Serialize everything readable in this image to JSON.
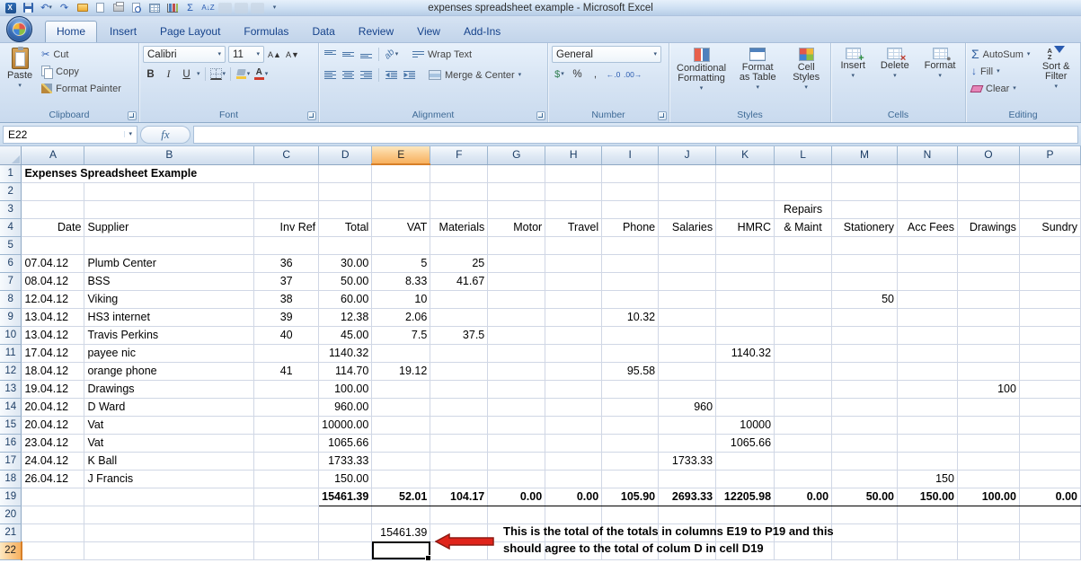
{
  "window": {
    "title": "expenses spreadsheet example - Microsoft Excel"
  },
  "icons": {
    "dropdown": "▾",
    "scissors": "✂",
    "sigma": "Σ",
    "undo": "↶",
    "redo": "↷",
    "bold": "B",
    "italic": "I",
    "underline": "U",
    "grow_font": "A▲",
    "shrink_font": "A▼",
    "font_a": "A",
    "dollar": "$",
    "percent": "%",
    "comma": ",",
    "increase_decimal": "←.0",
    "decrease_decimal": ".00→",
    "fill_down": "↓",
    "sort_az": "A↓Z"
  },
  "ribbon": {
    "tabs": [
      {
        "label": "Home",
        "active": true
      },
      {
        "label": "Insert"
      },
      {
        "label": "Page Layout"
      },
      {
        "label": "Formulas"
      },
      {
        "label": "Data"
      },
      {
        "label": "Review"
      },
      {
        "label": "View"
      },
      {
        "label": "Add-Ins"
      }
    ],
    "clipboard": {
      "label": "Clipboard",
      "paste": "Paste",
      "cut": "Cut",
      "copy": "Copy",
      "format_painter": "Format Painter"
    },
    "font": {
      "label": "Font",
      "family": "Calibri",
      "size": "11"
    },
    "alignment": {
      "label": "Alignment",
      "wrap_text": "Wrap Text",
      "merge_center": "Merge & Center"
    },
    "number": {
      "label": "Number",
      "format": "General"
    },
    "styles": {
      "label": "Styles",
      "conditional_formatting": "Conditional Formatting",
      "format_as_table": "Format as Table",
      "cell_styles": "Cell Styles"
    },
    "cells": {
      "label": "Cells",
      "insert": "Insert",
      "delete": "Delete",
      "format": "Format"
    },
    "editing": {
      "label": "Editing",
      "autosum": "AutoSum",
      "fill": "Fill",
      "clear": "Clear",
      "sort_filter": "Sort & Filter"
    }
  },
  "formula_bar": {
    "name_box": "E22",
    "fx_label": "fx"
  },
  "sheet": {
    "col_headers": [
      "A",
      "B",
      "C",
      "D",
      "E",
      "F",
      "G",
      "H",
      "I",
      "J",
      "K",
      "L",
      "M",
      "N",
      "O",
      "P"
    ],
    "row_count": 22,
    "selected_cell": "E22",
    "selected_col": "E",
    "selected_row": 22,
    "cells": [
      {
        "r": 1,
        "c": "A",
        "v": "Expenses Spreadsheet Example",
        "b": 1,
        "span": 3
      },
      {
        "r": 3,
        "c": "L",
        "v": "Repairs",
        "a": "center"
      },
      {
        "r": 4,
        "c": "A",
        "v": "Date",
        "a": "right"
      },
      {
        "r": 4,
        "c": "B",
        "v": "Supplier"
      },
      {
        "r": 4,
        "c": "C",
        "v": "Inv Ref",
        "a": "right"
      },
      {
        "r": 4,
        "c": "D",
        "v": "Total",
        "a": "right"
      },
      {
        "r": 4,
        "c": "E",
        "v": "VAT",
        "a": "right"
      },
      {
        "r": 4,
        "c": "F",
        "v": "Materials",
        "a": "right"
      },
      {
        "r": 4,
        "c": "G",
        "v": "Motor",
        "a": "right"
      },
      {
        "r": 4,
        "c": "H",
        "v": "Travel",
        "a": "right"
      },
      {
        "r": 4,
        "c": "I",
        "v": "Phone",
        "a": "right"
      },
      {
        "r": 4,
        "c": "J",
        "v": "Salaries",
        "a": "right"
      },
      {
        "r": 4,
        "c": "K",
        "v": "HMRC",
        "a": "right"
      },
      {
        "r": 4,
        "c": "L",
        "v": "& Maint",
        "a": "center"
      },
      {
        "r": 4,
        "c": "M",
        "v": "Stationery",
        "a": "right"
      },
      {
        "r": 4,
        "c": "N",
        "v": "Acc Fees",
        "a": "right"
      },
      {
        "r": 4,
        "c": "O",
        "v": "Drawings",
        "a": "right"
      },
      {
        "r": 4,
        "c": "P",
        "v": "Sundry",
        "a": "right"
      },
      {
        "r": 6,
        "c": "A",
        "v": "07.04.12"
      },
      {
        "r": 6,
        "c": "B",
        "v": "Plumb Center"
      },
      {
        "r": 6,
        "c": "C",
        "v": "36",
        "a": "center"
      },
      {
        "r": 6,
        "c": "D",
        "v": "30.00",
        "a": "right"
      },
      {
        "r": 6,
        "c": "E",
        "v": "5",
        "a": "right"
      },
      {
        "r": 6,
        "c": "F",
        "v": "25",
        "a": "right"
      },
      {
        "r": 7,
        "c": "A",
        "v": "08.04.12"
      },
      {
        "r": 7,
        "c": "B",
        "v": "BSS"
      },
      {
        "r": 7,
        "c": "C",
        "v": "37",
        "a": "center"
      },
      {
        "r": 7,
        "c": "D",
        "v": "50.00",
        "a": "right"
      },
      {
        "r": 7,
        "c": "E",
        "v": "8.33",
        "a": "right"
      },
      {
        "r": 7,
        "c": "F",
        "v": "41.67",
        "a": "right"
      },
      {
        "r": 8,
        "c": "A",
        "v": "12.04.12"
      },
      {
        "r": 8,
        "c": "B",
        "v": "Viking"
      },
      {
        "r": 8,
        "c": "C",
        "v": "38",
        "a": "center"
      },
      {
        "r": 8,
        "c": "D",
        "v": "60.00",
        "a": "right"
      },
      {
        "r": 8,
        "c": "E",
        "v": "10",
        "a": "right"
      },
      {
        "r": 8,
        "c": "M",
        "v": "50",
        "a": "right"
      },
      {
        "r": 9,
        "c": "A",
        "v": "13.04.12"
      },
      {
        "r": 9,
        "c": "B",
        "v": "HS3 internet"
      },
      {
        "r": 9,
        "c": "C",
        "v": "39",
        "a": "center"
      },
      {
        "r": 9,
        "c": "D",
        "v": "12.38",
        "a": "right"
      },
      {
        "r": 9,
        "c": "E",
        "v": "2.06",
        "a": "right"
      },
      {
        "r": 9,
        "c": "I",
        "v": "10.32",
        "a": "right"
      },
      {
        "r": 10,
        "c": "A",
        "v": "13.04.12"
      },
      {
        "r": 10,
        "c": "B",
        "v": "Travis Perkins"
      },
      {
        "r": 10,
        "c": "C",
        "v": "40",
        "a": "center"
      },
      {
        "r": 10,
        "c": "D",
        "v": "45.00",
        "a": "right"
      },
      {
        "r": 10,
        "c": "E",
        "v": "7.5",
        "a": "right"
      },
      {
        "r": 10,
        "c": "F",
        "v": "37.5",
        "a": "right"
      },
      {
        "r": 11,
        "c": "A",
        "v": "17.04.12"
      },
      {
        "r": 11,
        "c": "B",
        "v": "payee nic"
      },
      {
        "r": 11,
        "c": "D",
        "v": "1140.32",
        "a": "right"
      },
      {
        "r": 11,
        "c": "K",
        "v": "1140.32",
        "a": "right"
      },
      {
        "r": 12,
        "c": "A",
        "v": "18.04.12"
      },
      {
        "r": 12,
        "c": "B",
        "v": "orange phone"
      },
      {
        "r": 12,
        "c": "C",
        "v": "41",
        "a": "center"
      },
      {
        "r": 12,
        "c": "D",
        "v": "114.70",
        "a": "right"
      },
      {
        "r": 12,
        "c": "E",
        "v": "19.12",
        "a": "right"
      },
      {
        "r": 12,
        "c": "I",
        "v": "95.58",
        "a": "right"
      },
      {
        "r": 13,
        "c": "A",
        "v": "19.04.12"
      },
      {
        "r": 13,
        "c": "B",
        "v": "Drawings"
      },
      {
        "r": 13,
        "c": "D",
        "v": "100.00",
        "a": "right"
      },
      {
        "r": 13,
        "c": "O",
        "v": "100",
        "a": "right"
      },
      {
        "r": 14,
        "c": "A",
        "v": "20.04.12"
      },
      {
        "r": 14,
        "c": "B",
        "v": "D Ward"
      },
      {
        "r": 14,
        "c": "D",
        "v": "960.00",
        "a": "right"
      },
      {
        "r": 14,
        "c": "J",
        "v": "960",
        "a": "right"
      },
      {
        "r": 15,
        "c": "A",
        "v": "20.04.12"
      },
      {
        "r": 15,
        "c": "B",
        "v": "Vat"
      },
      {
        "r": 15,
        "c": "D",
        "v": "10000.00",
        "a": "right"
      },
      {
        "r": 15,
        "c": "K",
        "v": "10000",
        "a": "right"
      },
      {
        "r": 16,
        "c": "A",
        "v": "23.04.12"
      },
      {
        "r": 16,
        "c": "B",
        "v": "Vat"
      },
      {
        "r": 16,
        "c": "D",
        "v": "1065.66",
        "a": "right"
      },
      {
        "r": 16,
        "c": "K",
        "v": "1065.66",
        "a": "right"
      },
      {
        "r": 17,
        "c": "A",
        "v": "24.04.12"
      },
      {
        "r": 17,
        "c": "B",
        "v": "K Ball"
      },
      {
        "r": 17,
        "c": "D",
        "v": "1733.33",
        "a": "right"
      },
      {
        "r": 17,
        "c": "J",
        "v": "1733.33",
        "a": "right"
      },
      {
        "r": 18,
        "c": "A",
        "v": "26.04.12"
      },
      {
        "r": 18,
        "c": "B",
        "v": "J Francis"
      },
      {
        "r": 18,
        "c": "D",
        "v": "150.00",
        "a": "right"
      },
      {
        "r": 18,
        "c": "N",
        "v": "150",
        "a": "right"
      },
      {
        "r": 19,
        "c": "D",
        "v": "15461.39",
        "a": "right",
        "b": 1,
        "t": 1
      },
      {
        "r": 19,
        "c": "E",
        "v": "52.01",
        "a": "right",
        "b": 1,
        "t": 1
      },
      {
        "r": 19,
        "c": "F",
        "v": "104.17",
        "a": "right",
        "b": 1,
        "t": 1
      },
      {
        "r": 19,
        "c": "G",
        "v": "0.00",
        "a": "right",
        "b": 1,
        "t": 1
      },
      {
        "r": 19,
        "c": "H",
        "v": "0.00",
        "a": "right",
        "b": 1,
        "t": 1
      },
      {
        "r": 19,
        "c": "I",
        "v": "105.90",
        "a": "right",
        "b": 1,
        "t": 1
      },
      {
        "r": 19,
        "c": "J",
        "v": "2693.33",
        "a": "right",
        "b": 1,
        "t": 1
      },
      {
        "r": 19,
        "c": "K",
        "v": "12205.98",
        "a": "right",
        "b": 1,
        "t": 1
      },
      {
        "r": 19,
        "c": "L",
        "v": "0.00",
        "a": "right",
        "b": 1,
        "t": 1
      },
      {
        "r": 19,
        "c": "M",
        "v": "50.00",
        "a": "right",
        "b": 1,
        "t": 1
      },
      {
        "r": 19,
        "c": "N",
        "v": "150.00",
        "a": "right",
        "b": 1,
        "t": 1
      },
      {
        "r": 19,
        "c": "O",
        "v": "100.00",
        "a": "right",
        "b": 1,
        "t": 1
      },
      {
        "r": 19,
        "c": "P",
        "v": "0.00",
        "a": "right",
        "b": 1,
        "t": 1
      },
      {
        "r": 21,
        "c": "E",
        "v": "15461.39",
        "a": "right"
      }
    ]
  },
  "annotation": {
    "line1": "This is the total of the totals in columns E19 to P19 and this",
    "line2": "should agree to the total of colum D in cell D19",
    "arrow_color": "#e0241b"
  }
}
